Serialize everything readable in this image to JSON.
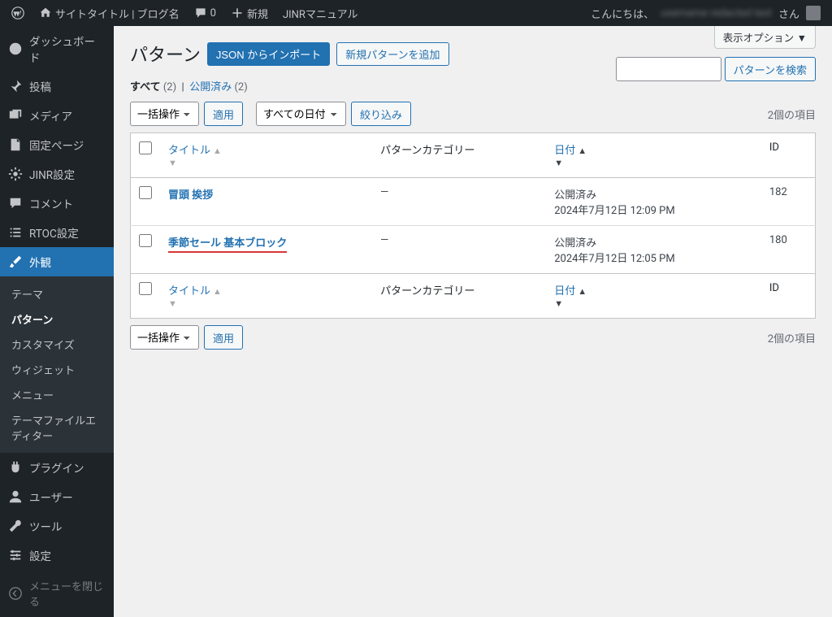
{
  "toolbar": {
    "site": "サイトタイトル | ブログ名",
    "comments": "0",
    "new": "新規",
    "manual": "JINRマニュアル",
    "greeting": "こんにちは、",
    "suffix": "さん"
  },
  "screen_options": "表示オプション ▼",
  "sidebar": {
    "dashboard": "ダッシュボード",
    "posts": "投稿",
    "media": "メディア",
    "pages": "固定ページ",
    "jinr": "JINR設定",
    "comments": "コメント",
    "rtoc": "RTOC設定",
    "appearance": "外観",
    "submenu": {
      "themes": "テーマ",
      "patterns": "パターン",
      "customize": "カスタマイズ",
      "widgets": "ウィジェット",
      "menus": "メニュー",
      "theme_editor": "テーマファイルエディター"
    },
    "plugins": "プラグイン",
    "users": "ユーザー",
    "tools": "ツール",
    "settings": "設定",
    "collapse": "メニューを閉じる"
  },
  "page": {
    "title": "パターン",
    "import_btn": "JSON からインポート",
    "add_btn": "新規パターンを追加"
  },
  "filters": {
    "all": "すべて",
    "all_count": "(2)",
    "published": "公開済み",
    "published_count": "(2)"
  },
  "search": {
    "btn": "パターンを検索"
  },
  "actions": {
    "bulk": "一括操作",
    "apply": "適用",
    "dates": "すべての日付",
    "filter": "絞り込み"
  },
  "items_count": "2個の項目",
  "cols": {
    "title": "タイトル",
    "category": "パターンカテゴリー",
    "date": "日付",
    "id": "ID"
  },
  "rows": [
    {
      "title": "冒頭 挨拶",
      "category": "—",
      "status": "公開済み",
      "date": "2024年7月12日 12:09 PM",
      "id": "182"
    },
    {
      "title": "季節セール 基本ブロック",
      "category": "—",
      "status": "公開済み",
      "date": "2024年7月12日 12:05 PM",
      "id": "180"
    }
  ]
}
